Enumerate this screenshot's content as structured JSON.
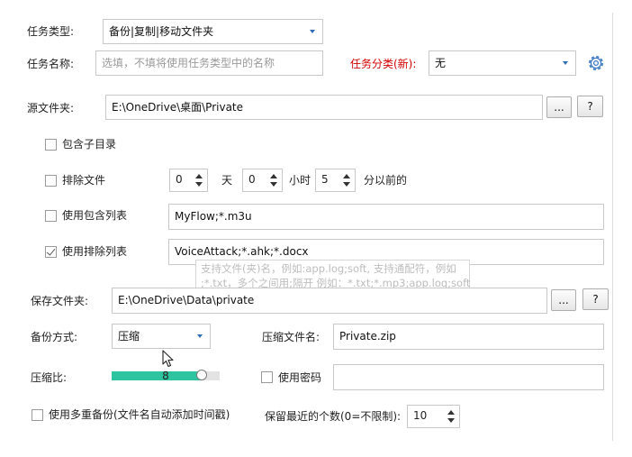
{
  "task": {
    "type_label": "任务类型:",
    "type_value": "备份|复制|移动文件夹",
    "name_label": "任务名称:",
    "name_placeholder": "选填，不填将使用任务类型中的名称",
    "category_label": "任务分类(新):",
    "category_value": "无"
  },
  "source": {
    "label": "源文件夹:",
    "path": "E:\\OneDrive\\桌面\\Private",
    "browse_label": "...",
    "help_label": "?"
  },
  "options": {
    "include_subdirs": {
      "label": "包含子目录",
      "checked": false
    },
    "exclude_files": {
      "label": "排除文件",
      "checked": false,
      "days": "0",
      "days_unit": "天",
      "hours": "0",
      "hours_unit": "小时",
      "minutes": "5",
      "minutes_unit": "分以前的"
    },
    "include_list": {
      "label": "使用包含列表",
      "checked": false,
      "value": "MyFlow;*.m3u"
    },
    "exclude_list": {
      "label": "使用排除列表",
      "checked": true,
      "value": "VoiceAttack;*.ahk;*.docx"
    },
    "tooltip_line1": "支持文件(夹)名，例如:app.log;soft, 支持通配符，例如",
    "tooltip_line2": ";*.txt，多个之间用;隔开 例如：*.txt;*.mp3;app.log;soft"
  },
  "destination": {
    "label": "保存文件夹:",
    "path": "E:\\OneDrive\\Data\\private",
    "browse_label": "...",
    "help_label": "?"
  },
  "backup": {
    "method_label": "备份方式:",
    "method_value": "压缩",
    "zip_name_label": "压缩文件名:",
    "zip_name_value": "Private.zip",
    "ratio_label": "压缩比:",
    "ratio_value": "8",
    "ratio_fraction": 0.83,
    "password_label": "使用密码",
    "password_checked": false,
    "password_value": "",
    "multi_label": "使用多重备份(文件名自动添加时间戳)",
    "multi_checked": false,
    "keep_label": "保留最近的个数(0=不限制):",
    "keep_value": "10"
  },
  "colors": {
    "accent": "#2e6db5",
    "slider_fill": "#2ec4a0",
    "required_label": "#d40000"
  }
}
